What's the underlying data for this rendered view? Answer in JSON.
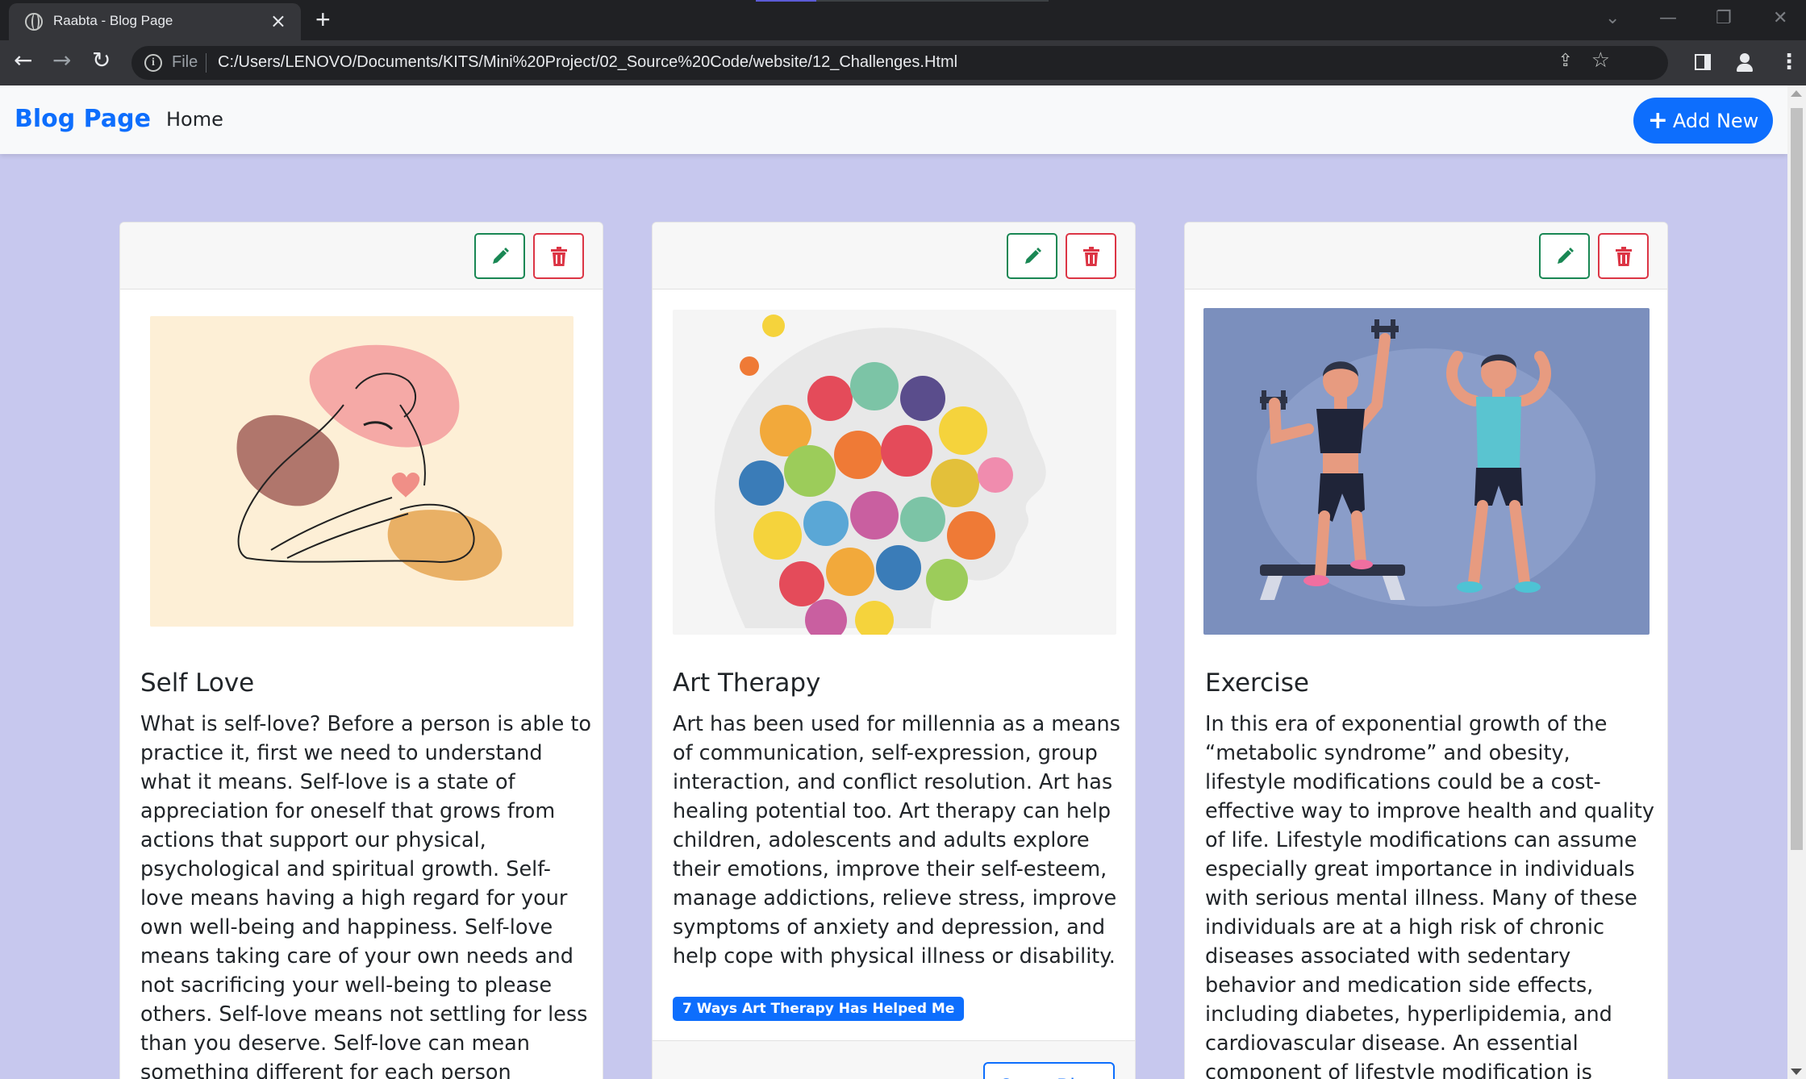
{
  "browser": {
    "tab_title": "Raabta - Blog Page",
    "tab_close": "×",
    "new_tab": "+",
    "url_scheme": "File",
    "url": "C:/Users/LENOVO/Documents/KITS/Mini%20Project/02_Source%20Code/website/12_Challenges.Html"
  },
  "navbar": {
    "brand": "Blog Page",
    "home": "Home",
    "add_new": "Add New"
  },
  "cards": [
    {
      "title": "Self Love",
      "text": "What is self-love? Before a person is able to practice it, first we need to understand what it means. Self-love is a state of appreciation for oneself that grows from actions that support our physical, psychological and spiritual growth. Self-love means having a high regard for your own well-being and happiness. Self-love means taking care of your own needs and not sacrificing your well-being to please others. Self-love means not settling for less than you deserve. Self-love can mean something different for each person because we all have many different",
      "image": "woman-hugging-herself-illustration"
    },
    {
      "title": "Art Therapy",
      "text": "Art has been used for millennia as a means of communication, self-expression, group interaction, and conflict resolution. Art has healing potential too. Art therapy can help children, adolescents and adults explore their emotions, improve their self-esteem, manage addictions, relieve stress, improve symptoms of anxiety and depression, and help cope with physical illness or disability.",
      "badge": "7 Ways Art Therapy Has Helped Me",
      "open_button": "Open Blog",
      "image": "colorful-head-collage-illustration"
    },
    {
      "title": "Exercise",
      "text": "In this era of exponential growth of the “metabolic syndrome” and obesity, lifestyle modifications could be a cost-effective way to improve health and quality of life. Lifestyle modifications can assume especially great importance in individuals with serious mental illness. Many of these individuals are at a high risk of chronic diseases associated with sedentary behavior and medication side effects, including diabetes, hyperlipidemia, and cardiovascular disease. An essential component of lifestyle modification is exercise.",
      "image": "two-people-exercising-illustration"
    }
  ],
  "colors": {
    "page_bg": "#c7c8ee",
    "primary": "#0d6efd",
    "success": "#198754",
    "danger": "#dc3545"
  }
}
